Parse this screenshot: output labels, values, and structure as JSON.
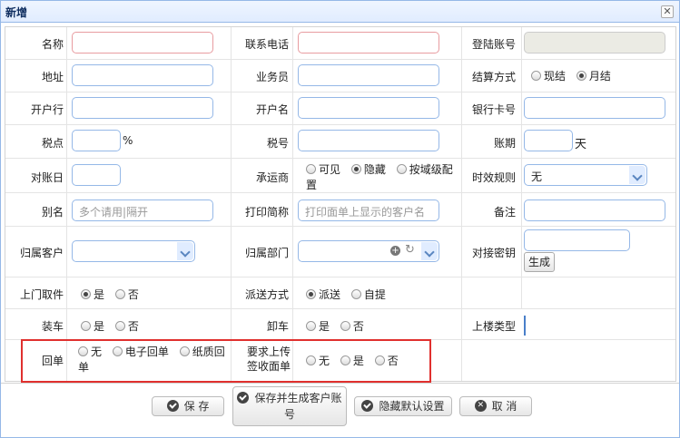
{
  "dialog": {
    "title": "新增",
    "close_glyph": "✕"
  },
  "row1": {
    "name_label": "名称",
    "phone_label": "联系电话",
    "login_label": "登陆账号"
  },
  "row2": {
    "address_label": "地址",
    "salesman_label": "业务员",
    "settle_label": "结算方式",
    "settle_options": [
      "现结",
      "月结"
    ],
    "settle_selected": "月结"
  },
  "row3": {
    "bank_label": "开户行",
    "account_name_label": "开户名",
    "card_label": "银行卡号"
  },
  "row4": {
    "tax_point_label": "税点",
    "tax_point_unit": "%",
    "tax_no_label": "税号",
    "period_label": "账期",
    "period_unit": "天"
  },
  "row5": {
    "reconcile_label": "对账日",
    "carrier_label": "承运商",
    "carrier_options": [
      "可见",
      "隐藏",
      "按域级配置"
    ],
    "carrier_selected": "隐藏",
    "timeliness_label": "时效规则",
    "timeliness_value": "无"
  },
  "row6": {
    "alias_label": "别名",
    "alias_placeholder": "多个请用|隔开",
    "print_label": "打印简称",
    "print_placeholder": "打印面单上显示的客户名",
    "remark_label": "备注"
  },
  "row7": {
    "owner_customer_label": "归属客户",
    "owner_dept_label": "归属部门",
    "secret_label": "对接密钥",
    "generate_label": "生成"
  },
  "row8": {
    "pickup_label": "上门取件",
    "pickup_options": [
      "是",
      "否"
    ],
    "pickup_selected": "是",
    "delivery_label": "派送方式",
    "delivery_options": [
      "派送",
      "自提"
    ],
    "delivery_selected": "派送"
  },
  "row9": {
    "load_label": "装车",
    "load_options": [
      "是",
      "否"
    ],
    "unload_label": "卸车",
    "unload_options": [
      "是",
      "否"
    ],
    "upstairs_label": "上楼类型"
  },
  "row10": {
    "receipt_label": "回单",
    "receipt_options": [
      "无",
      "电子回单",
      "纸质回单"
    ],
    "sign_label_1": "要求上传",
    "sign_label_2": "签收面单",
    "sign_options": [
      "无",
      "是",
      "否"
    ]
  },
  "footer": {
    "save": "保 存",
    "save_gen_1": "保存并生成客户账",
    "save_gen_2": "号",
    "hide_default": "隐藏默认设置",
    "cancel": "取 消"
  }
}
